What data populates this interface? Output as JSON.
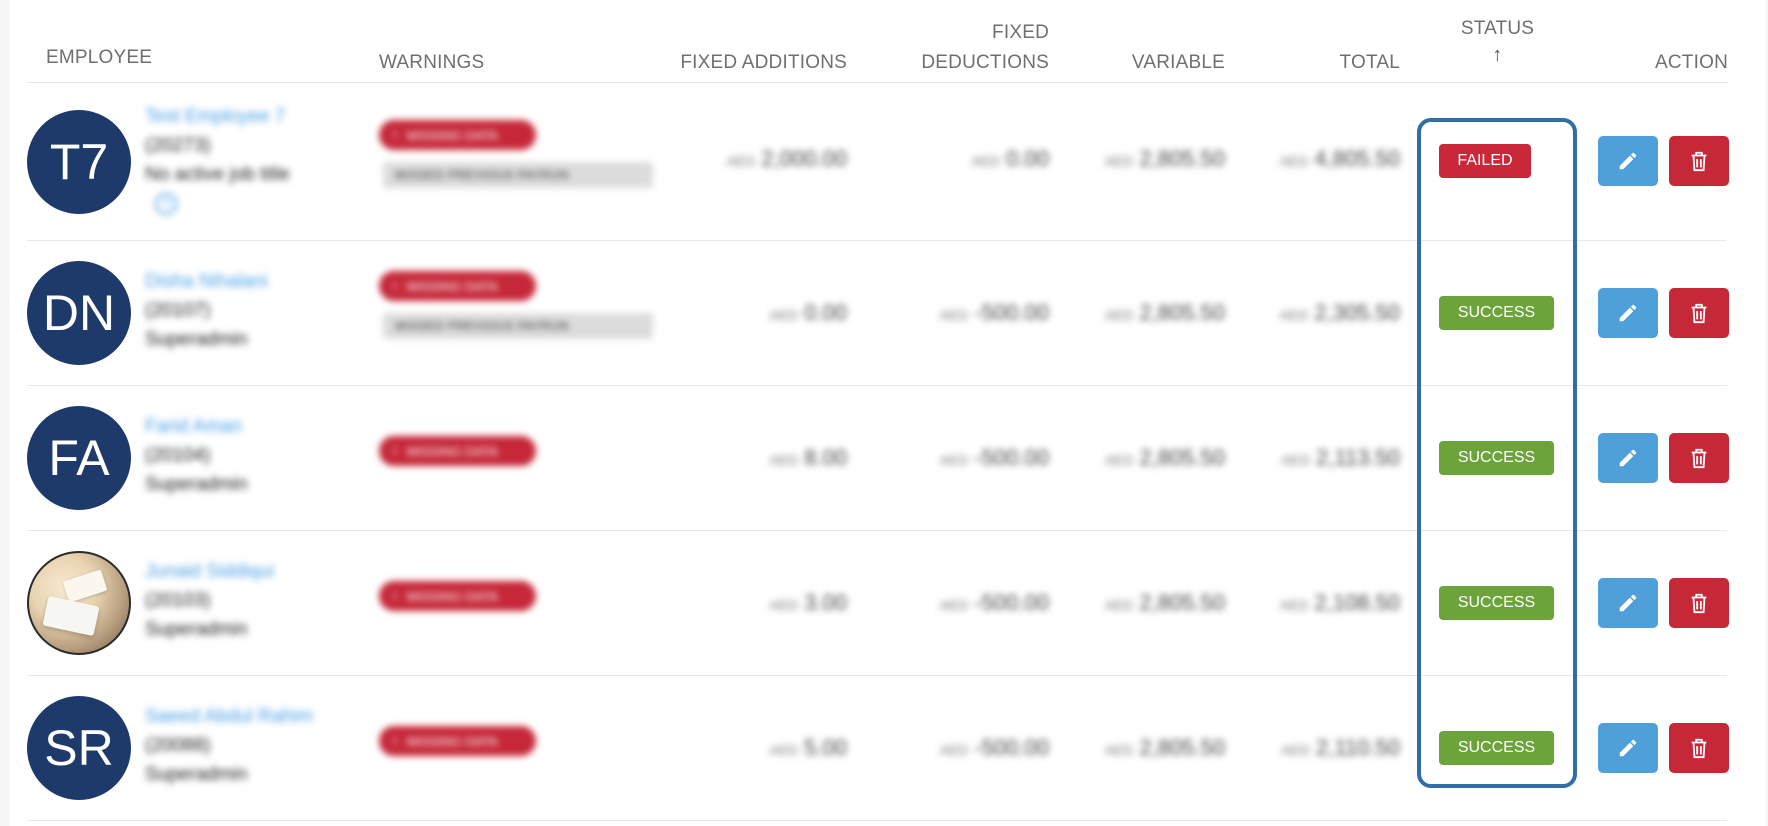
{
  "table": {
    "headers": {
      "employee": "EMPLOYEE",
      "warnings": "WARNINGS",
      "fixed_additions": "FIXED ADDITIONS",
      "fixed_deductions_line1": "FIXED",
      "fixed_deductions_line2": "DEDUCTIONS",
      "variable": "VARIABLE",
      "total": "TOTAL",
      "status": "STATUS",
      "status_sort_arrow": "↑",
      "action": "ACTION"
    },
    "rows": [
      {
        "avatar_initials": "T7",
        "name": "Test Employee 7",
        "employee_id": "(20273)",
        "job_title": "No active job title",
        "warning_label": "MISSING DATA",
        "warning_tag": "MISSED PREVIOUS PAYRUN",
        "fixed_additions": "2,000.00",
        "fixed_deductions": "0.00",
        "variable": "2,805.50",
        "total": "4,805.50",
        "currency": "AED",
        "status": "FAILED"
      },
      {
        "avatar_initials": "DN",
        "name": "Disha Nihalani",
        "employee_id": "(20107)",
        "job_title": "Superadmin",
        "warning_label": "MISSING DATA",
        "warning_tag": "MISSED PREVIOUS PAYRUN",
        "fixed_additions": "0.00",
        "fixed_deductions": "-500.00",
        "variable": "2,805.50",
        "total": "2,305.50",
        "currency": "AED",
        "status": "SUCCESS"
      },
      {
        "avatar_initials": "FA",
        "name": "Farid Aman",
        "employee_id": "(20104)",
        "job_title": "Superadmin",
        "warning_label": "MISSING DATA",
        "fixed_additions": "8.00",
        "fixed_deductions": "-500.00",
        "variable": "2,805.50",
        "total": "2,113.50",
        "currency": "AED",
        "status": "SUCCESS"
      },
      {
        "avatar_initials": "",
        "name": "Junaid Siddiqui",
        "employee_id": "(20103)",
        "job_title": "Superadmin",
        "warning_label": "MISSING DATA",
        "fixed_additions": "3.00",
        "fixed_deductions": "-500.00",
        "variable": "2,805.50",
        "total": "2,108.50",
        "currency": "AED",
        "status": "SUCCESS"
      },
      {
        "avatar_initials": "SR",
        "name": "Saeed Abdul Rahim",
        "employee_id": "(20088)",
        "job_title": "Superadmin",
        "warning_label": "MISSING DATA",
        "fixed_additions": "5.00",
        "fixed_deductions": "-500.00",
        "variable": "2,805.50",
        "total": "2,110.50",
        "currency": "AED",
        "status": "SUCCESS"
      }
    ]
  },
  "icons": {
    "edit": "pencil-icon",
    "delete": "trash-icon",
    "warning": "exclamation-icon",
    "help": "question-circle-icon"
  },
  "colors": {
    "failed": "#c8283a",
    "success": "#6ca33b",
    "edit_button": "#4f9fd9",
    "delete_button": "#c62838",
    "avatar": "#1d3a6b",
    "highlight_frame": "#2f6ea6"
  }
}
